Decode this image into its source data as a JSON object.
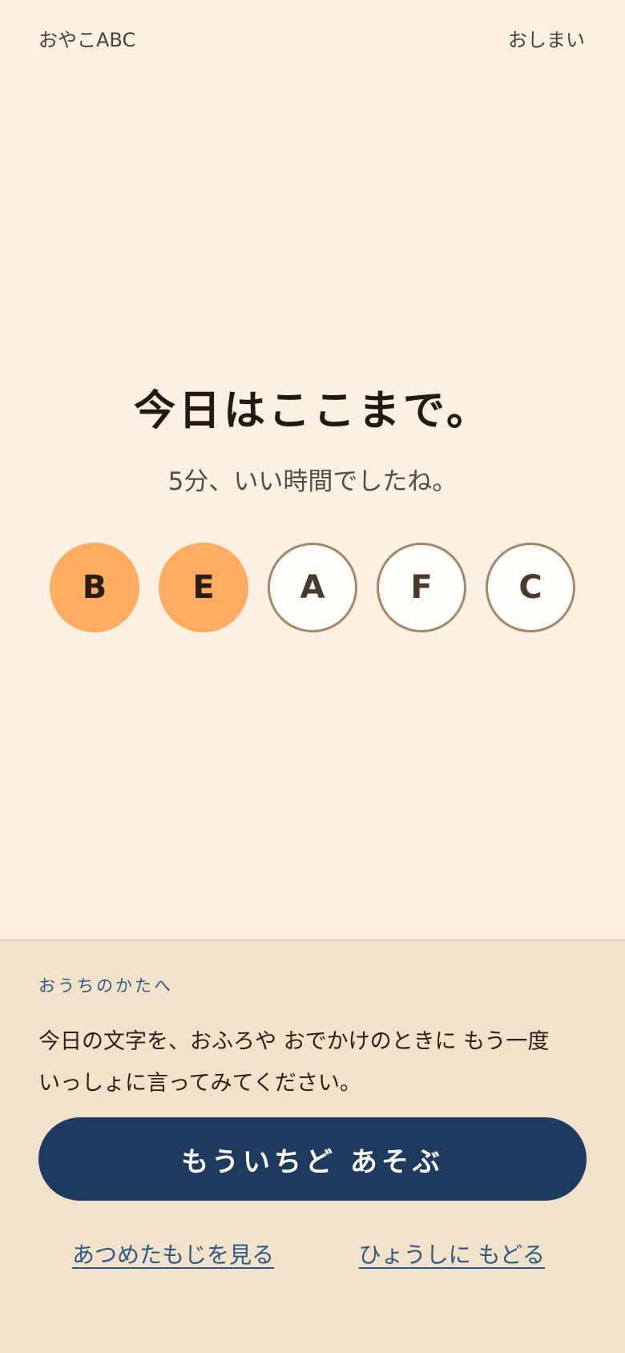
{
  "header": {
    "brand": "おやこABC",
    "end_label": "おしまい"
  },
  "main": {
    "title": "今日はここまで。",
    "subtitle": "5分、いい時間でしたね。",
    "letters": [
      {
        "char": "B",
        "state": "collected"
      },
      {
        "char": "E",
        "state": "collected"
      },
      {
        "char": "A",
        "state": "not-collected"
      },
      {
        "char": "F",
        "state": "not-collected"
      },
      {
        "char": "C",
        "state": "not-collected"
      }
    ]
  },
  "parent_panel": {
    "label": "おうちのかたへ",
    "message_line1": "今日の文字を、おふろや おでかけのときに もう一度",
    "message_line2": "いっしょに言ってみてください。",
    "play_again_label": "もういちど あそぶ",
    "collected_link_label": "あつめたもじを見る",
    "cover_link_label": "ひょうしに もどる"
  },
  "colors": {
    "background": "#fcf0e3",
    "panel": "#f3e2ca",
    "collected_letter": "#ffac62",
    "letter_outline": "#a38766",
    "primary_button": "#1f3a5f",
    "link": "#2b5886"
  }
}
